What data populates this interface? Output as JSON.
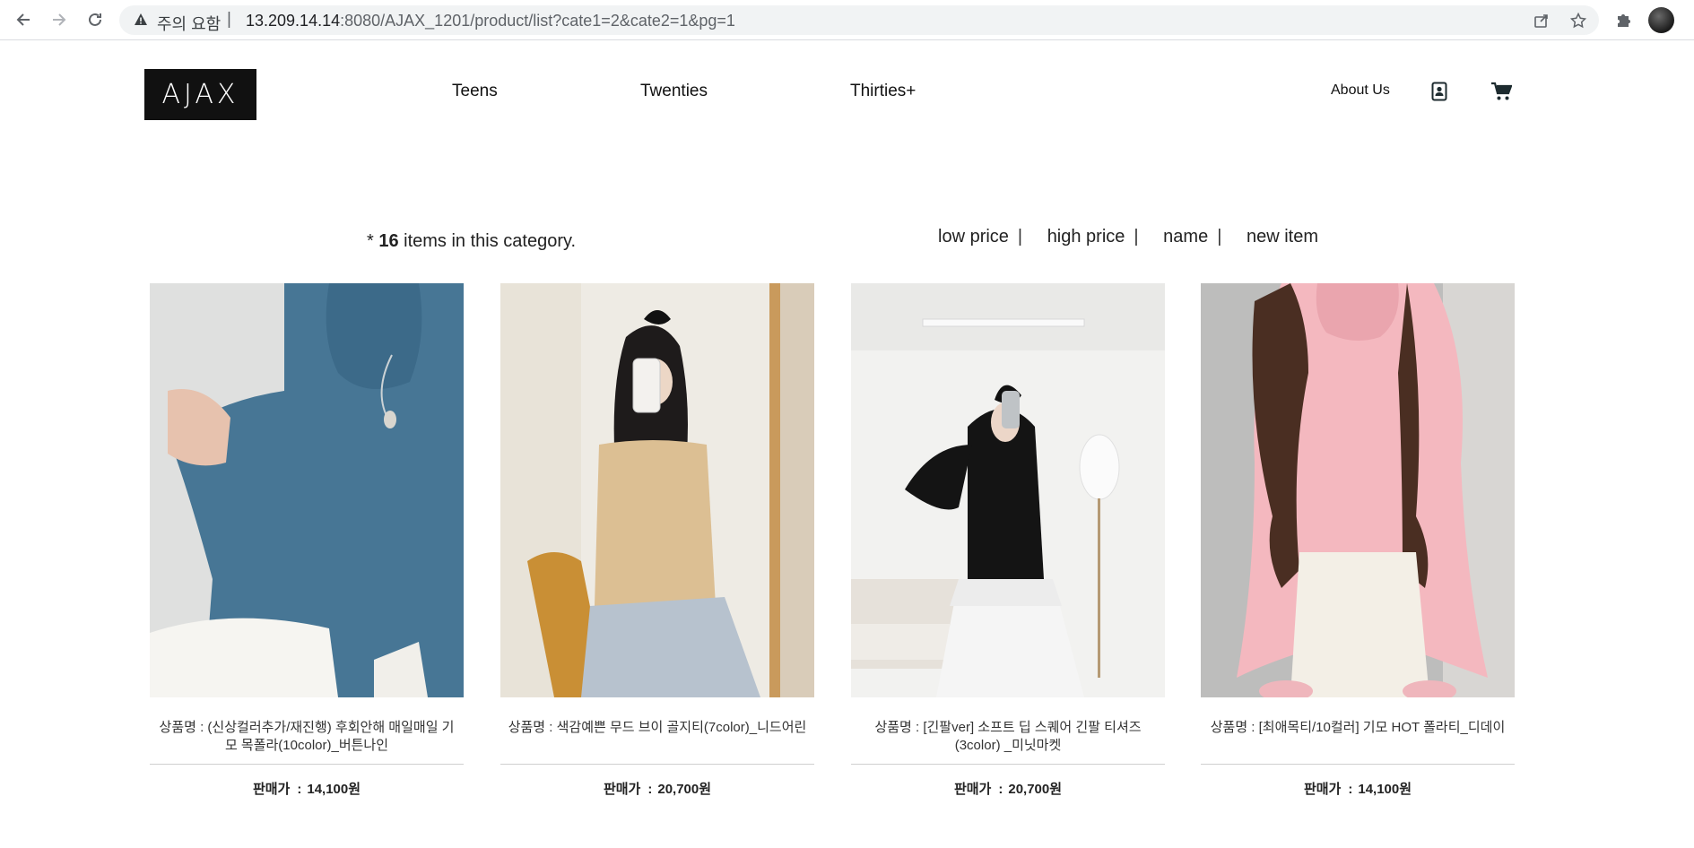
{
  "browser": {
    "status": "주의 요함",
    "separator": "|",
    "url_host": "13.209.14.14",
    "url_rest": ":8080/AJAX_1201/product/list?cate1=2&cate2=1&pg=1"
  },
  "site": {
    "logo": "AJAX",
    "nav": [
      "Teens",
      "Twenties",
      "Thirties+"
    ],
    "about": "About Us"
  },
  "listing": {
    "count_prefix": "* ",
    "count": "16",
    "count_suffix": " items in this category.",
    "sort": [
      "low price",
      "high price",
      "name",
      "new item"
    ],
    "sort_bar": "|"
  },
  "products": [
    {
      "name": "상품명 : (신상컬러추가/재진행) 후회안해 매일매일 기모 목폴라(10color)_버튼나인",
      "price_label": "판매가",
      "price": "14,100원"
    },
    {
      "name": "상품명 : 색감예쁜 무드 브이 골지티(7color)_니드어린",
      "price_label": "판매가",
      "price": "20,700원"
    },
    {
      "name": "상품명 : [긴팔ver] 소프트 딥 스퀘어 긴팔 티셔즈(3color) _미닛마켓",
      "price_label": "판매가",
      "price": "20,700원"
    },
    {
      "name": "상품명 : [최애목티/10컬러] 기모 HOT 폴라티_디데이",
      "price_label": "판매가",
      "price": "14,100원"
    }
  ],
  "colors": {
    "logo_bg": "#111111",
    "accent_icon": "#1d2b2f"
  }
}
